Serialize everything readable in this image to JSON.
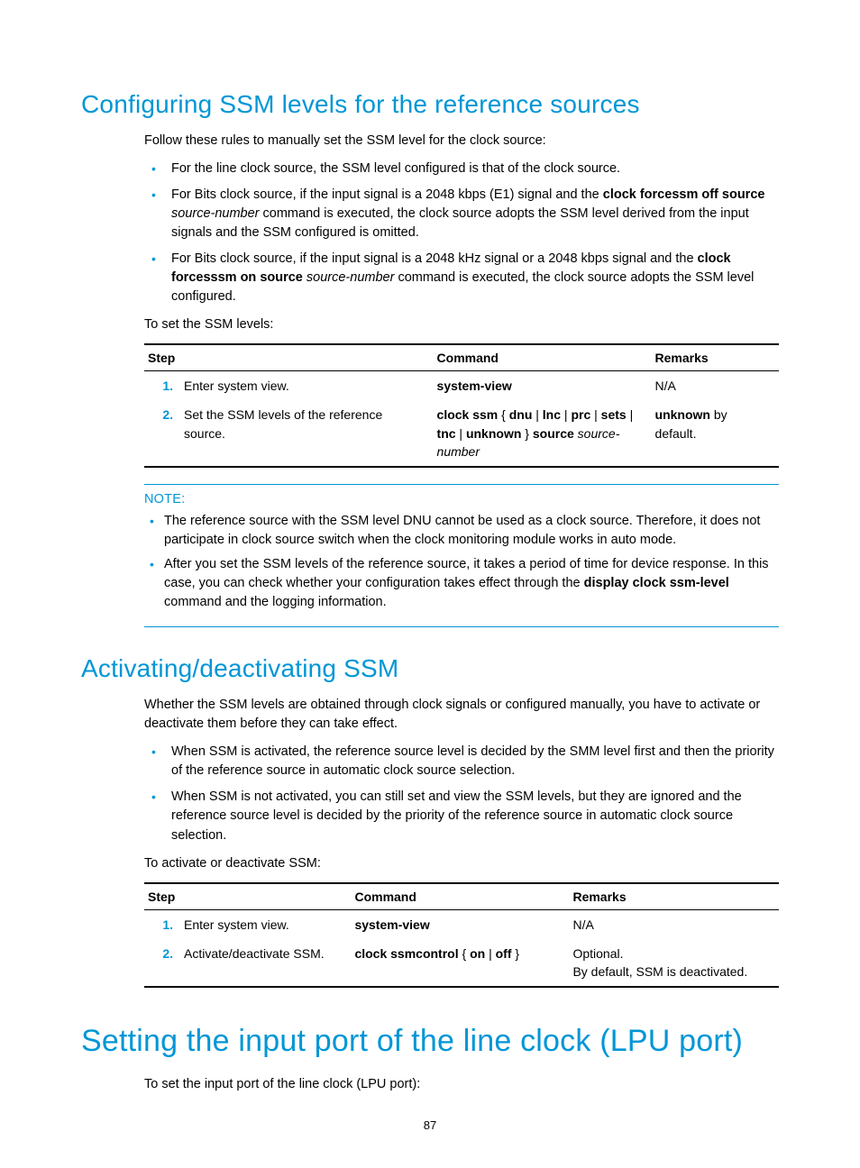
{
  "section1": {
    "title": "Configuring SSM levels for the reference sources",
    "intro": "Follow these rules to manually set the SSM level for the clock source:",
    "bullets": {
      "b1": "For the line clock source, the SSM level configured is that of the clock source.",
      "b2_pre": "For Bits clock source, if the input signal is a 2048 kbps (E1) signal and the ",
      "b2_bold": "clock forcessm off source",
      "b2_it": " source-number",
      "b2_post": " command is executed, the clock source adopts the SSM level derived from the input signals and the SSM configured is omitted.",
      "b3_pre": "For Bits clock source, if the input signal is a 2048 kHz signal or a 2048 kbps signal and the ",
      "b3_bold": "clock forcesssm on source",
      "b3_it": " source-number",
      "b3_post": " command is executed, the clock source adopts the SSM level configured."
    },
    "lead2": "To set the SSM levels:",
    "table_hdr": {
      "step": "Step",
      "command": "Command",
      "remarks": "Remarks"
    },
    "rows": {
      "r1": {
        "num": "1.",
        "step": "Enter system view.",
        "cmd_b": "system-view",
        "remarks": "N/A"
      },
      "r2": {
        "num": "2.",
        "step": "Set the SSM levels of the reference source.",
        "cmd_b1": "clock ssm",
        "cmd_p1": " { ",
        "cmd_b2": "dnu",
        "cmd_sep": " | ",
        "cmd_b3": "lnc",
        "cmd_b4": "prc",
        "cmd_b5": "sets",
        "cmd_b6": "tnc",
        "cmd_b7": "unknown",
        "cmd_p2": " } ",
        "cmd_b8": "source",
        "cmd_it": "source-number",
        "rem_b": "unknown",
        "rem_t": " by default."
      }
    },
    "note_label": "NOTE:",
    "notes": {
      "n1": "The reference source with the SSM level DNU cannot be used as a clock source. Therefore, it does not participate in clock source switch when the clock monitoring module works in auto mode.",
      "n2_pre": "After you set the SSM levels of the reference source, it takes a period of time for device response. In this case, you can check whether your configuration takes effect through the ",
      "n2_bold": "display clock ssm-level",
      "n2_post": " command and the logging information."
    }
  },
  "section2": {
    "title": "Activating/deactivating SSM",
    "intro": "Whether the SSM levels are obtained through clock signals or configured manually, you have to activate or deactivate them before they can take effect.",
    "bullets": {
      "b1": "When SSM is activated, the reference source level is decided by the SMM level first and then the priority of the reference source in automatic clock source selection.",
      "b2": "When SSM is not activated, you can still set and view the SSM levels, but they are ignored and the reference source level is decided by the priority of the reference source in automatic clock source selection."
    },
    "lead2": "To activate or deactivate SSM:",
    "table_hdr": {
      "step": "Step",
      "command": "Command",
      "remarks": "Remarks"
    },
    "rows": {
      "r1": {
        "num": "1.",
        "step": "Enter system view.",
        "cmd_b": "system-view",
        "remarks": "N/A"
      },
      "r2": {
        "num": "2.",
        "step": "Activate/deactivate SSM.",
        "cmd_b1": "clock ssmcontrol",
        "cmd_p1": " { ",
        "cmd_b2": "on",
        "cmd_sep": " | ",
        "cmd_b3": "off",
        "cmd_p2": " }",
        "rem1": "Optional.",
        "rem2": "By default, SSM is deactivated."
      }
    }
  },
  "section3": {
    "title": "Setting the input port of the line clock (LPU port)",
    "intro": "To set the input port of the line clock (LPU port):"
  },
  "page_number": "87"
}
